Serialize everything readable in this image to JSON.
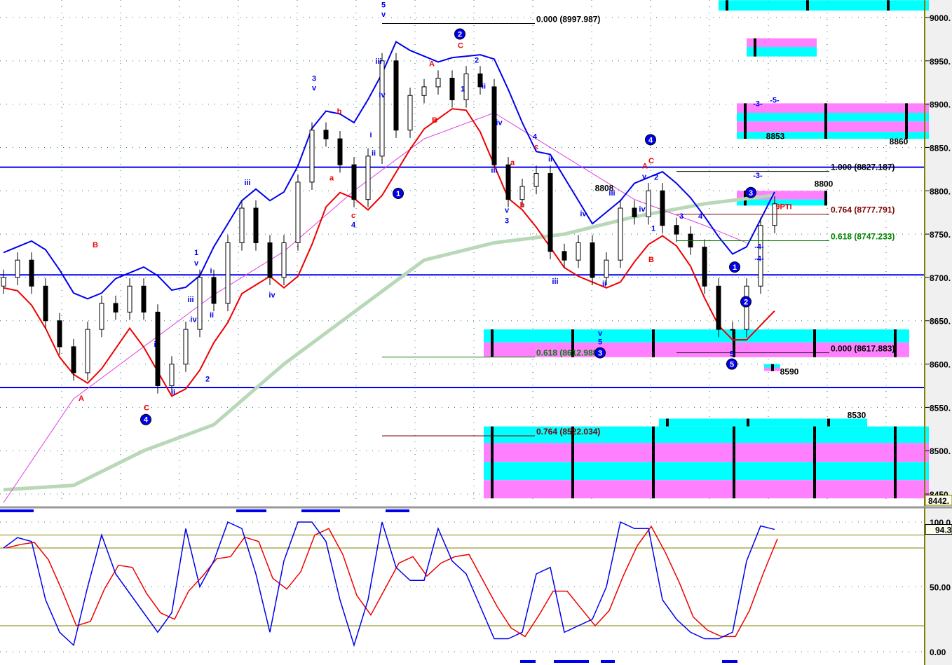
{
  "chart_data": [
    {
      "type": "candlestick",
      "title": "",
      "price_axis": {
        "min": 8442,
        "max": 9020,
        "ticks": [
          "9000.",
          "8950.",
          "8900.",
          "8850.",
          "8800.",
          "8750.",
          "8700.",
          "8650.",
          "8600.",
          "8550.",
          "8500.",
          "8450."
        ],
        "tick_values": [
          9000,
          8950,
          8900,
          8850,
          8800,
          8750,
          8700,
          8650,
          8600,
          8550,
          8500,
          8450
        ],
        "last_value_label": "8442."
      },
      "closes": [
        8700,
        8720,
        8690,
        8650,
        8620,
        8590,
        8640,
        8670,
        8660,
        8690,
        8660,
        8575,
        8600,
        8640,
        8700,
        8670,
        8740,
        8780,
        8740,
        8700,
        8740,
        8810,
        8870,
        8860,
        8830,
        8790,
        8840,
        8950,
        8870,
        8910,
        8920,
        8930,
        8905,
        8935,
        8920,
        8830,
        8790,
        8805,
        8820,
        8730,
        8720,
        8740,
        8700,
        8720,
        8780,
        8770,
        8800,
        8760,
        8750,
        8735,
        8690,
        8640,
        8640,
        8690,
        8760,
        8785
      ],
      "ma_slow": [
        [
          0,
          8455
        ],
        [
          5,
          8460
        ],
        [
          10,
          8500
        ],
        [
          15,
          8530
        ],
        [
          20,
          8600
        ],
        [
          25,
          8660
        ],
        [
          30,
          8720
        ],
        [
          35,
          8740
        ],
        [
          40,
          8750
        ],
        [
          45,
          8770
        ],
        [
          50,
          8785
        ],
        [
          55,
          8795
        ]
      ],
      "ma_mid": [
        [
          0,
          8440
        ],
        [
          5,
          8560
        ],
        [
          10,
          8620
        ],
        [
          15,
          8680
        ],
        [
          20,
          8730
        ],
        [
          25,
          8800
        ],
        [
          30,
          8860
        ],
        [
          35,
          8890
        ],
        [
          40,
          8840
        ],
        [
          45,
          8790
        ],
        [
          50,
          8760
        ],
        [
          53,
          8740
        ]
      ],
      "horizontal_lines": [
        {
          "price": 8827.187,
          "color": "#0000ee"
        },
        {
          "price": 8703,
          "color": "#0000ee"
        },
        {
          "price": 8573,
          "color": "#0000ee"
        }
      ],
      "fib_labels": [
        {
          "text": "0.000 (8997.987)",
          "price": 8997.987,
          "bar": 38,
          "color": "#000000"
        },
        {
          "text": "1.000 (8827.187)",
          "price": 8827.187,
          "bar": 59,
          "color": "#000000"
        },
        {
          "text": "0.764 (8777.791)",
          "price": 8777.791,
          "bar": 59,
          "color": "#800000"
        },
        {
          "text": "0.618 (8747.233)",
          "price": 8747.233,
          "bar": 59,
          "color": "#008000"
        },
        {
          "text": "0.618 (8612.988)",
          "price": 8612.988,
          "bar": 38,
          "color": "#008000"
        },
        {
          "text": "0.000 (8617.883)",
          "price": 8617.883,
          "bar": 59,
          "color": "#000000"
        },
        {
          "text": "0.764 (8522.034)",
          "price": 8522.034,
          "bar": 38,
          "color": "#800000"
        }
      ],
      "zones": [
        {
          "bar_from": 51,
          "bar_to": 66,
          "bands": [
            [
              "cyan",
              9020,
              9008
            ]
          ]
        },
        {
          "bar_from": 53,
          "bar_to": 58,
          "bands": [
            [
              "pink",
              8976,
              8966
            ],
            [
              "cyan",
              8966,
              8955
            ]
          ]
        },
        {
          "bar_from": 52.3,
          "bar_to": 66,
          "bands": [
            [
              "pink",
              8901,
              8890
            ],
            [
              "cyan",
              8890,
              8880
            ],
            [
              "pink",
              8880,
              8868
            ],
            [
              "cyan",
              8868,
              8860
            ]
          ]
        },
        {
          "bar_from": 52.3,
          "bar_to": 58.6,
          "bands": [
            [
              "pink",
              8800,
              8790
            ],
            [
              "cyan",
              8790,
              8783
            ]
          ]
        },
        {
          "bar_from": 34.25,
          "bar_to": 64.6,
          "bands": [
            [
              "cyan",
              8640,
              8625
            ],
            [
              "pink",
              8625,
              8608
            ]
          ]
        },
        {
          "bar_from": 54.25,
          "bar_to": 55.4,
          "bands": [
            [
              "cyan",
              8600,
              8596
            ],
            [
              "pink",
              8596,
              8592
            ]
          ]
        },
        {
          "bar_from": 46.75,
          "bar_to": 61.6,
          "bands": [
            [
              "cyan",
              8537,
              8528
            ]
          ]
        },
        {
          "bar_from": 34.25,
          "bar_to": 66,
          "bands": [
            [
              "cyan",
              8528,
              8509
            ],
            [
              "pink",
              8509,
              8487
            ],
            [
              "cyan",
              8487,
              8466
            ],
            [
              "pink",
              8466,
              8445
            ]
          ]
        }
      ],
      "wave_labels": [
        {
          "t": "5",
          "bar": 27.1,
          "price": 9015,
          "c": "b"
        },
        {
          "t": "v",
          "bar": 27.1,
          "price": 9004,
          "c": "b"
        },
        {
          "t": "2",
          "bar": 32.55,
          "price": 8981,
          "c": "b",
          "circled": true
        },
        {
          "t": "C",
          "bar": 32.6,
          "price": 8968,
          "c": "r"
        },
        {
          "t": "2",
          "bar": 33.75,
          "price": 8951,
          "c": "b"
        },
        {
          "t": "A",
          "bar": 30.55,
          "price": 8947,
          "c": "r"
        },
        {
          "t": "B",
          "bar": 30.75,
          "price": 8882,
          "c": "r"
        },
        {
          "t": "iii",
          "bar": 26.75,
          "price": 8950,
          "c": "b"
        },
        {
          "t": "iv",
          "bar": 27,
          "price": 8911,
          "c": "b"
        },
        {
          "t": "3",
          "bar": 22.15,
          "price": 8930,
          "c": "b"
        },
        {
          "t": "v",
          "bar": 22.15,
          "price": 8919,
          "c": "b"
        },
        {
          "t": "b",
          "bar": 23.95,
          "price": 8892,
          "c": "r"
        },
        {
          "t": "a",
          "bar": 23.4,
          "price": 8815,
          "c": "r"
        },
        {
          "t": "c",
          "bar": 24.95,
          "price": 8772,
          "c": "r"
        },
        {
          "t": "4",
          "bar": 24.95,
          "price": 8761,
          "c": "b"
        },
        {
          "t": "i",
          "bar": 26.2,
          "price": 8865,
          "c": "b"
        },
        {
          "t": "ii",
          "bar": 26.4,
          "price": 8844,
          "c": "b"
        },
        {
          "t": "1",
          "bar": 28.15,
          "price": 8797,
          "c": "b",
          "circled": true
        },
        {
          "t": "iii",
          "bar": 17.4,
          "price": 8810,
          "c": "b"
        },
        {
          "t": "iv",
          "bar": 19.15,
          "price": 8680,
          "c": "b"
        },
        {
          "t": "1",
          "bar": 13.75,
          "price": 8729,
          "c": "b"
        },
        {
          "t": "v",
          "bar": 13.75,
          "price": 8717,
          "c": "b"
        },
        {
          "t": "iii",
          "bar": 13.35,
          "price": 8675,
          "c": "b"
        },
        {
          "t": "iv",
          "bar": 13.55,
          "price": 8652,
          "c": "b"
        },
        {
          "t": "ii",
          "bar": 14.85,
          "price": 8657,
          "c": "b"
        },
        {
          "t": "i",
          "bar": 14.8,
          "price": 8708,
          "c": "b"
        },
        {
          "t": "2",
          "bar": 14.55,
          "price": 8583,
          "c": "b"
        },
        {
          "t": "B",
          "bar": 6.55,
          "price": 8738,
          "c": "r"
        },
        {
          "t": "A",
          "bar": 5.55,
          "price": 8561,
          "c": "r"
        },
        {
          "t": "C",
          "bar": 10.2,
          "price": 8550,
          "c": "r"
        },
        {
          "t": "4",
          "bar": 10.15,
          "price": 8536,
          "c": "b",
          "circled": true
        },
        {
          "t": "i",
          "bar": 10.8,
          "price": 8623,
          "c": "b"
        },
        {
          "t": "ii",
          "bar": 12.1,
          "price": 8568,
          "c": "b"
        },
        {
          "t": "4",
          "bar": 37.9,
          "price": 8863,
          "c": "b"
        },
        {
          "t": "c",
          "bar": 38,
          "price": 8851,
          "c": "r"
        },
        {
          "t": "ii",
          "bar": 39,
          "price": 8837,
          "c": "b"
        },
        {
          "t": "iii",
          "bar": 35,
          "price": 8824,
          "c": "b"
        },
        {
          "t": "iv",
          "bar": 35.35,
          "price": 8879,
          "c": "b"
        },
        {
          "t": "ii",
          "bar": 34.25,
          "price": 8921,
          "c": "b"
        },
        {
          "t": "1",
          "bar": 32.75,
          "price": 8918,
          "c": "b"
        },
        {
          "t": "a",
          "bar": 36.3,
          "price": 8833,
          "c": "r"
        },
        {
          "t": "b",
          "bar": 37,
          "price": 8784,
          "c": "r"
        },
        {
          "t": "v",
          "bar": 35.9,
          "price": 8778,
          "c": "b"
        },
        {
          "t": "3",
          "bar": 35.9,
          "price": 8766,
          "c": "b"
        },
        {
          "t": "8808",
          "bar": 42.85,
          "price": 8803,
          "c": "k"
        },
        {
          "t": "4",
          "bar": 46.15,
          "price": 8859,
          "c": "b",
          "circled": true
        },
        {
          "t": "C",
          "bar": 46.2,
          "price": 8835,
          "c": "r"
        },
        {
          "t": "A",
          "bar": 45.75,
          "price": 8829,
          "c": "r"
        },
        {
          "t": "v",
          "bar": 45.7,
          "price": 8817,
          "c": "b"
        },
        {
          "t": "2",
          "bar": 46.55,
          "price": 8816,
          "c": "b"
        },
        {
          "t": "iv",
          "bar": 45.55,
          "price": 8779,
          "c": "b"
        },
        {
          "t": "iii",
          "bar": 43.4,
          "price": 8798,
          "c": "b"
        },
        {
          "t": "iv",
          "bar": 41.35,
          "price": 8774,
          "c": "b"
        },
        {
          "t": "iii",
          "bar": 39.35,
          "price": 8696,
          "c": "b"
        },
        {
          "t": "ii",
          "bar": 42.85,
          "price": 8693,
          "c": "b"
        },
        {
          "t": "v",
          "bar": 42.55,
          "price": 8636,
          "c": "b"
        },
        {
          "t": "5",
          "bar": 42.55,
          "price": 8626,
          "c": "b"
        },
        {
          "t": "3",
          "bar": 42.55,
          "price": 8613,
          "c": "b",
          "circled": true
        },
        {
          "t": "B",
          "bar": 46.2,
          "price": 8721,
          "c": "r"
        },
        {
          "t": "1",
          "bar": 46.35,
          "price": 8757,
          "c": "b"
        },
        {
          "t": "3",
          "bar": 48.35,
          "price": 8771,
          "c": "b"
        },
        {
          "t": "4",
          "bar": 49.7,
          "price": 8771,
          "c": "b"
        },
        {
          "t": "1",
          "bar": 52.15,
          "price": 8712,
          "c": "b",
          "circled": true
        },
        {
          "t": "2",
          "bar": 52.95,
          "price": 8672,
          "c": "b",
          "circled": true
        },
        {
          "t": "5",
          "bar": 51.95,
          "price": 8600,
          "c": "b",
          "circled": true
        },
        {
          "t": "5",
          "bar": 51.95,
          "price": 8612,
          "c": "b"
        },
        {
          "t": "-4-",
          "bar": 53.9,
          "price": 8736,
          "c": "b"
        },
        {
          "t": "-4-",
          "bar": 53.9,
          "price": 8722,
          "c": "b"
        },
        {
          "t": "-3-",
          "bar": 53.8,
          "price": 8818,
          "c": "b"
        },
        {
          "t": "3",
          "bar": 53.3,
          "price": 8798,
          "c": "b",
          "circled": true
        },
        {
          "t": "-3-",
          "bar": 53.8,
          "price": 8901,
          "c": "b"
        },
        {
          "t": "-5-",
          "bar": 55,
          "price": 8905,
          "c": "b"
        },
        {
          "t": "8853",
          "bar": 55.05,
          "price": 8863,
          "c": "k"
        },
        {
          "t": "8860",
          "bar": 63.85,
          "price": 8857,
          "c": "k"
        },
        {
          "t": "8800",
          "bar": 58.5,
          "price": 8808,
          "c": "k"
        },
        {
          "t": "8590",
          "bar": 56.05,
          "price": 8591,
          "c": "k"
        },
        {
          "t": "8530",
          "bar": 60.85,
          "price": 8541,
          "c": "k"
        },
        {
          "t": "9PTI",
          "bar": 55.65,
          "price": 8782,
          "c": "r"
        }
      ]
    },
    {
      "type": "line",
      "title": "Stochastic",
      "y_axis": {
        "min": 0,
        "max": 100,
        "ticks": [
          "100.0",
          "50.00",
          "0.00"
        ],
        "tick_values": [
          100,
          50,
          0
        ],
        "last_value_label": "94.3"
      },
      "reference_levels": [
        90,
        80,
        20
      ],
      "k": [
        80,
        88,
        85,
        40,
        15,
        5,
        50,
        90,
        60,
        45,
        30,
        15,
        30,
        95,
        50,
        70,
        100,
        95,
        60,
        15,
        70,
        100,
        100,
        85,
        40,
        5,
        40,
        100,
        65,
        55,
        55,
        95,
        70,
        60,
        35,
        10,
        10,
        15,
        60,
        65,
        15,
        20,
        25,
        50,
        100,
        95,
        95,
        40,
        25,
        15,
        10,
        10,
        15,
        70,
        97,
        94.3
      ]
    }
  ]
}
